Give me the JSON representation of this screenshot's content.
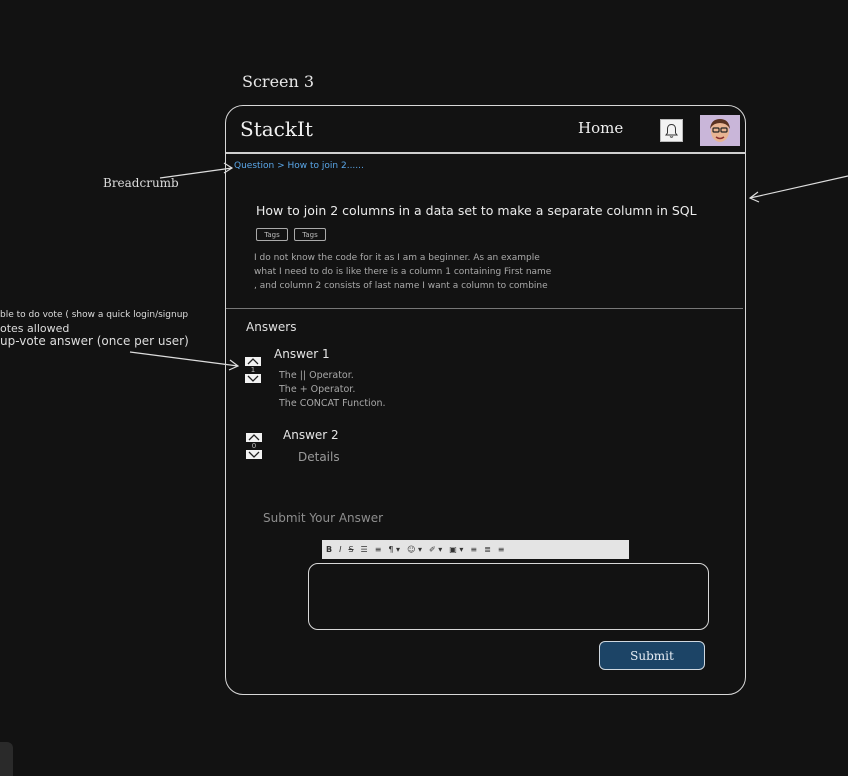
{
  "screen_label": "Screen 3",
  "header": {
    "brand": "StackIt",
    "home_label": "Home"
  },
  "breadcrumb": "Question > How to join 2......",
  "annotations": {
    "breadcrumb": "Breadcrumb",
    "vote_line1": "ble to do vote ( show a quick login/signup",
    "vote_line2": "otes allowed",
    "vote_line3": "up-vote answer (once per user)"
  },
  "question": {
    "title": "How to join 2 columns in a data set to make a separate column in SQL",
    "tags": [
      "Tags",
      "Tags"
    ],
    "body_lines": [
      "I do not know the code for it as I am a beginner. As an example",
      "what I need to do is like there is a column 1 containing First name",
      ", and column 2 consists of last name I want a column to combine"
    ]
  },
  "answers_heading": "Answers",
  "answers": [
    {
      "title": "Answer 1",
      "votes": "1",
      "lines": [
        "The || Operator.",
        "The + Operator.",
        "The CONCAT Function."
      ]
    },
    {
      "title": "Answer 2",
      "votes": "0",
      "lines": [
        "Details"
      ]
    }
  ],
  "submit_section": {
    "heading": "Submit Your Answer",
    "button_label": "Submit"
  },
  "toolbar": {
    "bold": "B",
    "italic": "I",
    "strike": "S",
    "ordered_list": "☰",
    "bullet_list": "≡",
    "paragraph": "¶ ▾",
    "emoji": "☺ ▾",
    "link": "✐ ▾",
    "image": "▣ ▾",
    "align_left": "≡",
    "align_center": "≣",
    "align_right": "≡"
  },
  "icons": {
    "bell": "bell-icon",
    "avatar": "avatar",
    "upvote": "chevron-up-icon",
    "downvote": "chevron-down-icon"
  }
}
